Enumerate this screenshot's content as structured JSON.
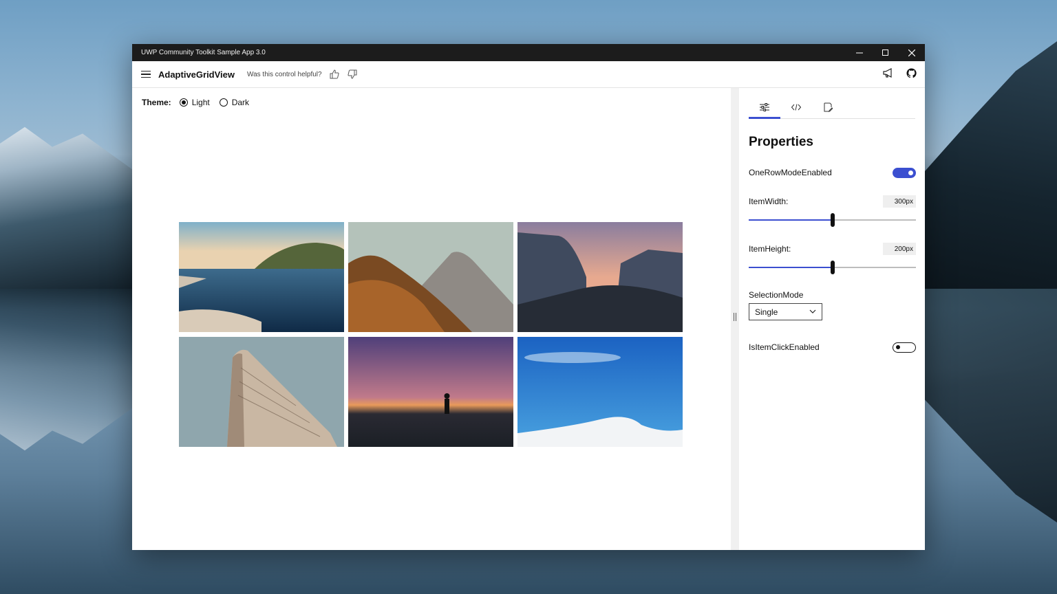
{
  "window": {
    "title": "UWP Community Toolkit Sample App 3.0",
    "controls": [
      "minimize",
      "maximize",
      "close"
    ]
  },
  "header": {
    "page_title": "AdaptiveGridView",
    "helpful_prompt": "Was this control helpful?"
  },
  "theme": {
    "label": "Theme:",
    "options": [
      {
        "label": "Light",
        "selected": true
      },
      {
        "label": "Dark",
        "selected": false
      }
    ]
  },
  "grid": {
    "images": [
      "lake-hills",
      "mountain-autumn",
      "valley-dusk",
      "flatiron-building",
      "beach-silhouette",
      "snow-dune"
    ]
  },
  "panel": {
    "tabs": [
      "properties-tab",
      "code-tab",
      "documentation-tab"
    ],
    "active_tab": "properties-tab",
    "title": "Properties",
    "one_row_mode": {
      "label": "OneRowModeEnabled",
      "on": true
    },
    "item_width": {
      "label": "ItemWidth:",
      "value_text": "300px",
      "fraction": 0.5
    },
    "item_height": {
      "label": "ItemHeight:",
      "value_text": "200px",
      "fraction": 0.5
    },
    "selection_mode": {
      "label": "SelectionMode",
      "value": "Single"
    },
    "item_click": {
      "label": "IsItemClickEnabled",
      "on": false
    }
  },
  "colors": {
    "accent": "#3b4fd0",
    "titlebar": "#1c1c1c"
  }
}
